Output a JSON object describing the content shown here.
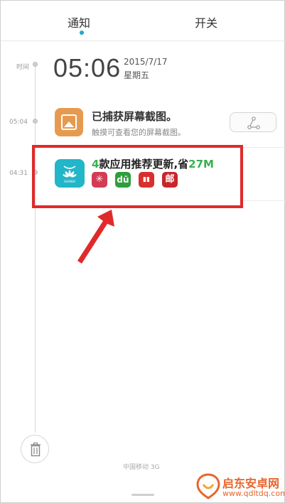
{
  "tabs": {
    "notify_label": "通知",
    "switch_label": "开关",
    "active": "notify",
    "accent": "#21a8c9"
  },
  "timeline": {
    "time_label": "时间",
    "entry1_time": "05:04",
    "entry2_time": "04:31"
  },
  "header": {
    "clock": "05:06",
    "date": "2015/7/17",
    "weekday": "星期五"
  },
  "notifications": [
    {
      "app_icon": "gallery-icon",
      "title": "已捕获屏幕截图。",
      "subtitle": "触摸可查看您的屏幕截图。",
      "action_icon": "share-icon"
    },
    {
      "app_icon": "huawei-appstore-icon",
      "app_icon_text": "HUAWEI",
      "title_prefix": "4",
      "title_middle": "款应用推荐更新,省",
      "title_suffix": "27M",
      "mini_apps": [
        {
          "icon": "asterisk-app-icon",
          "glyph": "✳",
          "color": "#d43b55"
        },
        {
          "icon": "du-app-icon",
          "glyph": "dū",
          "color": "#2e9e3c"
        },
        {
          "icon": "stocks-app-icon",
          "glyph": "▮▮",
          "color": "#d8302f"
        },
        {
          "icon": "mail-app-icon",
          "glyph": "邮",
          "color": "#c8262c"
        }
      ],
      "highlight_color": "#e02a2a"
    }
  ],
  "footer": {
    "carrier": "中国移动 3G",
    "trash_icon": "trash-icon"
  },
  "watermark": {
    "title": "启东安卓网",
    "url": "www.qdltdq.com"
  }
}
